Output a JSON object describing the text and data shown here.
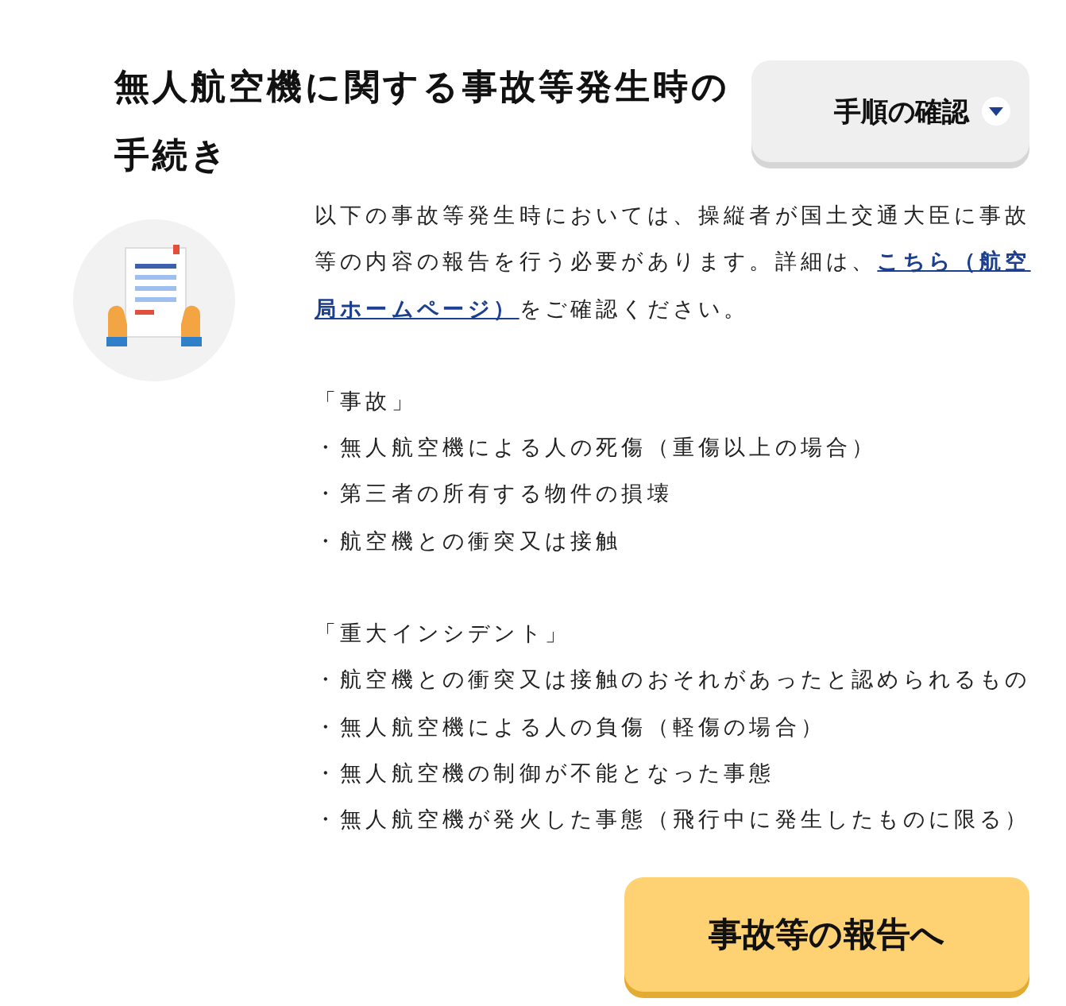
{
  "title": "無人航空機に関する事故等発生時の手続き",
  "toggle": {
    "label": "手順の確認",
    "expanded": false
  },
  "intro": {
    "before": "以下の事故等発生時においては、操縦者が国土交通大臣に事故等の内容の報告を行う必要があります。詳細は、",
    "link_parts": [
      "こちら（航空",
      "局ホームページ）"
    ],
    "after": "をご確認ください。"
  },
  "sections": [
    {
      "heading": "「事故」",
      "items": [
        "・無人航空機による人の死傷（重傷以上の場合）",
        "・第三者の所有する物件の損壊",
        "・航空機との衝突又は接触"
      ]
    },
    {
      "heading": "「重大インシデント」",
      "items": [
        "・航空機との衝突又は接触のおそれがあったと認められるもの",
        "・無人航空機による人の負傷（軽傷の場合）",
        "・無人航空機の制御が不能となった事態",
        "・無人航空機が発火した事態（飛行中に発生したものに限る）"
      ]
    }
  ],
  "report_button": "事故等の報告へ"
}
